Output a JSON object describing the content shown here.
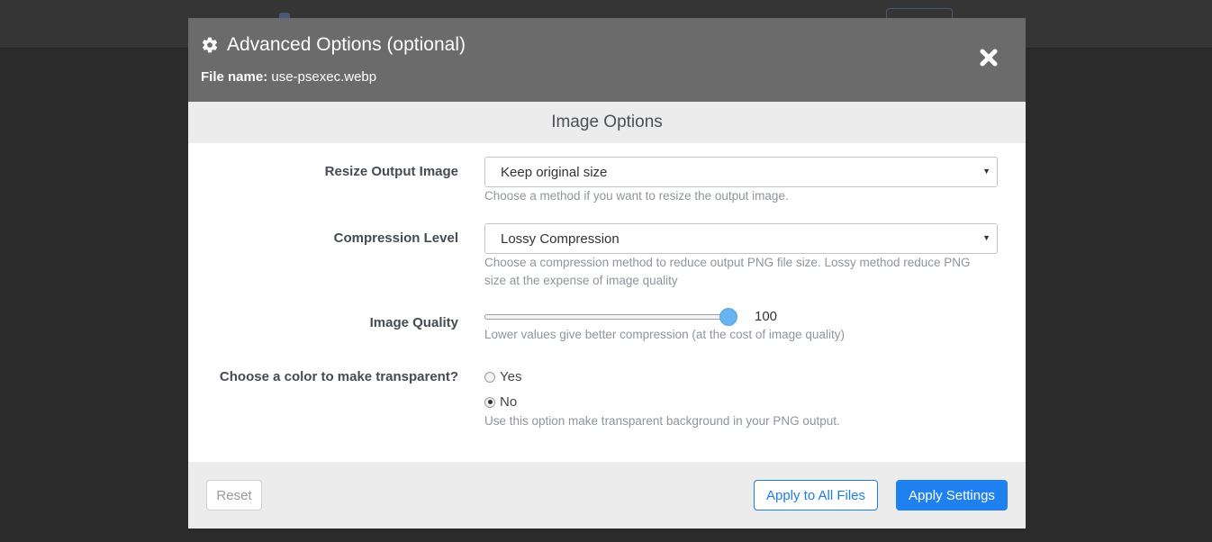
{
  "modal": {
    "title": "Advanced Options (optional)",
    "file_label": "File name:",
    "file_name": "use-psexec.webp",
    "section_title": "Image Options"
  },
  "resize": {
    "label": "Resize Output Image",
    "value": "Keep original size",
    "help": "Choose a method if you want to resize the output image."
  },
  "compression": {
    "label": "Compression Level",
    "value": "Lossy Compression",
    "help_line1": "Choose a compression method to reduce output PNG file size. Lossy method reduce PNG",
    "help_line2": "size at the expense of image quality"
  },
  "quality": {
    "label": "Image Quality",
    "value": "100",
    "slider_fraction": 1.0,
    "help": "Lower values give better compression (at the cost of image quality)"
  },
  "transparent": {
    "label": "Choose a color to make transparent?",
    "options": [
      "Yes",
      "No"
    ],
    "selected": "No",
    "help": "Use this option make transparent background in your PNG output."
  },
  "footer": {
    "reset_label": "Reset",
    "apply_all_label": "Apply to All Files",
    "apply_label": "Apply Settings"
  },
  "colors": {
    "accent": "#1f80f0",
    "header_bg": "#6b6b6b",
    "slider_thumb": "#66b3f2"
  },
  "icons": {
    "header": "gear-icon",
    "close": "close-icon",
    "select_caret": "caret-down-icon"
  }
}
